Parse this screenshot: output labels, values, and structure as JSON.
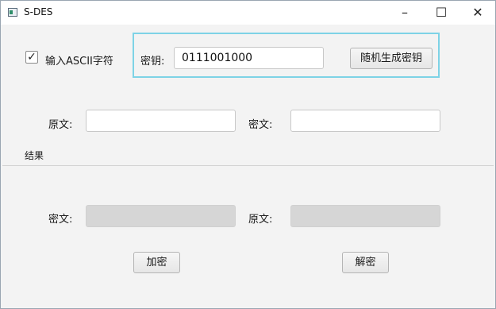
{
  "window": {
    "title": "S-DES"
  },
  "options": {
    "ascii_label": "输入ASCII字符",
    "ascii_checked": true
  },
  "key": {
    "label": "密钥:",
    "value": "0111001000",
    "random_button": "随机生成密钥"
  },
  "encrypt_input": {
    "plain_label": "原文:",
    "plain_value": "",
    "cipher_label": "密文:",
    "cipher_value": ""
  },
  "results": {
    "section_label": "结果",
    "cipher_label": "密文:",
    "cipher_value": "",
    "plain_label": "原文:",
    "plain_value": ""
  },
  "actions": {
    "encrypt": "加密",
    "decrypt": "解密"
  },
  "icons": {
    "minimize": "minimize-icon",
    "maximize": "maximize-icon",
    "close": "close-icon",
    "check": "checkmark-icon"
  },
  "colors": {
    "key_group_border": "#7ed3e6",
    "readonly_field": "#d6d6d6"
  }
}
